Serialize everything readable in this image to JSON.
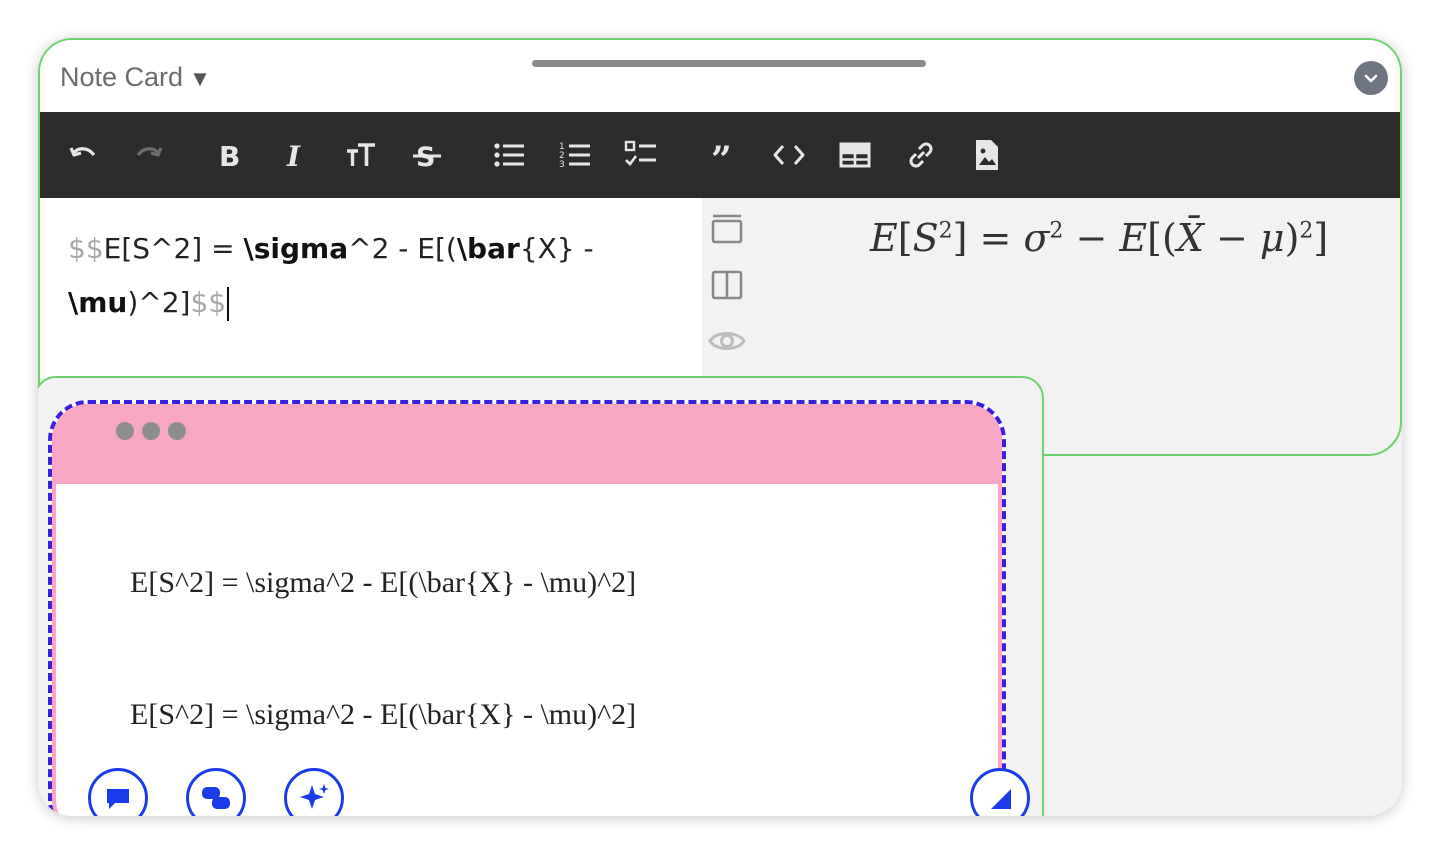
{
  "note_card": {
    "title": "Note Card",
    "caret": "▼"
  },
  "toolbar": {
    "items": [
      "undo-icon",
      "redo-icon",
      "bold-icon",
      "italic-icon",
      "text-size-icon",
      "strikethrough-icon",
      "bullet-list-icon",
      "numbered-list-icon",
      "checklist-icon",
      "quote-icon",
      "code-icon",
      "table-icon",
      "link-icon",
      "image-icon"
    ]
  },
  "editor": {
    "open_delim": "$$",
    "part1": "E[S^2] = ",
    "sigma": "\\sigma",
    "part2": "^2 - E[(",
    "bar": "\\bar",
    "part3": "{X} -",
    "mu": "\\mu",
    "part4": ")^2]",
    "close_delim": "$$"
  },
  "preview": {
    "E1": "E",
    "b1": "[",
    "S": "S",
    "exp1": "2",
    "b2": "]",
    "eq": " = ",
    "sigma": "σ",
    "exp2": "2",
    "minus": " − ",
    "E2": "E",
    "b3": "[(",
    "Xbar": "X̄",
    "minus2": " − ",
    "mu": "μ",
    "b4": ")",
    "exp3": "2",
    "b5": "]"
  },
  "overlay": {
    "line1": "E[S^2] = \\sigma^2 - E[(\\bar{X} - \\mu)^2]",
    "line2": "E[S^2] = \\sigma^2 - E[(\\bar{X} - \\mu)^2]"
  },
  "colors": {
    "green_border": "#6bd36b",
    "pink": "#f7a7c2",
    "blue_dash": "#3a1fe0",
    "fab_blue": "#1a3be8"
  }
}
